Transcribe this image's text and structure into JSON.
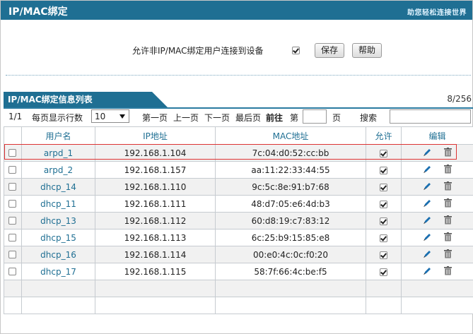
{
  "header": {
    "title": "IP/MAC绑定",
    "brand": "助您轻松连接世界"
  },
  "settings": {
    "allow_label": "允许非IP/MAC绑定用户连接到设备",
    "allow_checked": true,
    "save_label": "保存",
    "help_label": "帮助"
  },
  "list": {
    "tab_title": "IP/MAC绑定信息列表",
    "count": "8/256",
    "page": "1/1",
    "rows_per_page_label": "每页显示行数",
    "rows_per_page_value": "10",
    "first_page": "第一页",
    "prev_page": "上一页",
    "next_page": "下一页",
    "last_page": "最后页",
    "goto": "前往",
    "page_prefix": "第",
    "page_suffix": "页",
    "search_label": "搜索",
    "columns": [
      "用户名",
      "IP地址",
      "MAC地址",
      "允许",
      "编辑"
    ],
    "rows": [
      {
        "name": "arpd_1",
        "ip": "192.168.1.104",
        "mac": "7c:04:d0:52:cc:bb",
        "allow": true
      },
      {
        "name": "arpd_2",
        "ip": "192.168.1.157",
        "mac": "aa:11:22:33:44:55",
        "allow": true
      },
      {
        "name": "dhcp_14",
        "ip": "192.168.1.110",
        "mac": "9c:5c:8e:91:b7:68",
        "allow": true
      },
      {
        "name": "dhcp_11",
        "ip": "192.168.1.111",
        "mac": "48:d7:05:e6:4d:b3",
        "allow": true
      },
      {
        "name": "dhcp_13",
        "ip": "192.168.1.112",
        "mac": "60:d8:19:c7:83:12",
        "allow": true
      },
      {
        "name": "dhcp_15",
        "ip": "192.168.1.113",
        "mac": "6c:25:b9:15:85:e8",
        "allow": true
      },
      {
        "name": "dhcp_16",
        "ip": "192.168.1.114",
        "mac": "00:e0:4c:0c:f0:20",
        "allow": true
      },
      {
        "name": "dhcp_17",
        "ip": "192.168.1.115",
        "mac": "58:7f:66:4c:be:f5",
        "allow": true
      }
    ]
  },
  "icons": {
    "edit": "pencil-edit-icon",
    "delete": "trash-icon",
    "dropdown": "chevron-down-icon"
  },
  "colors": {
    "header_bg": "#1f6f93",
    "accent_text": "#1f6f93",
    "highlight": "#dd3333"
  }
}
